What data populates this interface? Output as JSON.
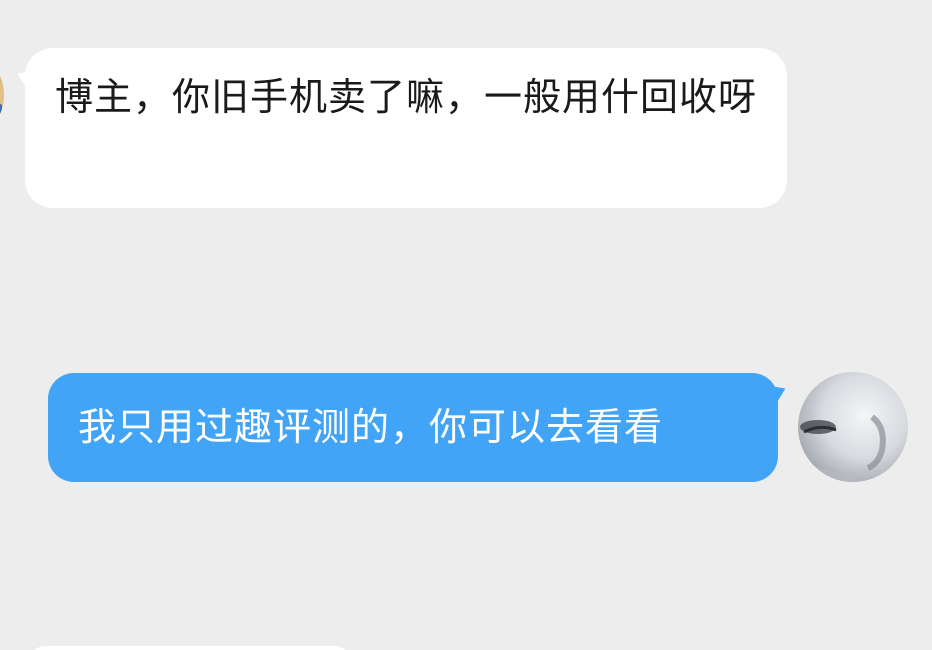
{
  "messages": [
    {
      "direction": "incoming",
      "text": "博主，你旧手机卖了嘛，一般用什回收呀",
      "bubble_color": "#ffffff",
      "avatar": "user-avatar"
    },
    {
      "direction": "outgoing",
      "text": "我只用过趣评测的，你可以去看看",
      "bubble_color": "#41a4f6",
      "avatar": "self-avatar"
    }
  ],
  "colors": {
    "background": "#ededed",
    "outgoing_bubble": "#41a4f6",
    "incoming_bubble": "#ffffff"
  }
}
